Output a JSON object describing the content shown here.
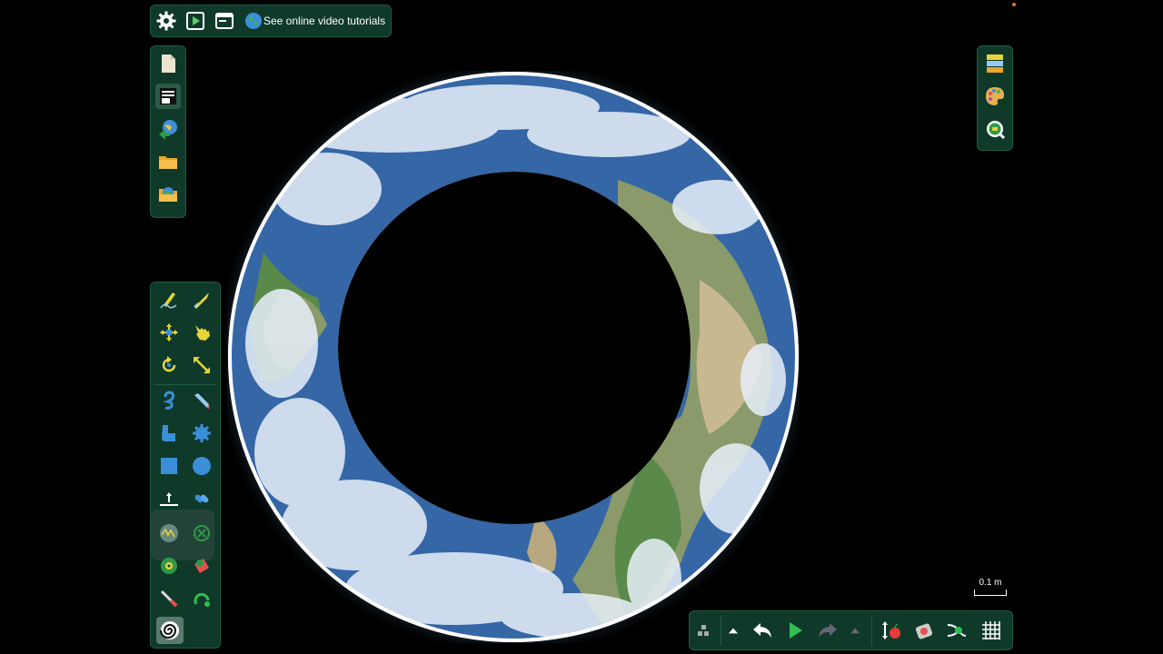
{
  "header": {
    "tutorials_label": "See online video tutorials"
  },
  "icons": {
    "settings": "gear-icon",
    "play_scene": "play-scene-icon",
    "window": "window-icon",
    "globe": "globe-icon"
  },
  "scale": {
    "label": "0.1 m"
  },
  "colors": {
    "panel_bg": "#0f3a2a",
    "panel_border": "#1f5a42",
    "accent_yellow": "#e8d43a",
    "accent_blue": "#3a8fd8",
    "play_green": "#2ec050"
  }
}
